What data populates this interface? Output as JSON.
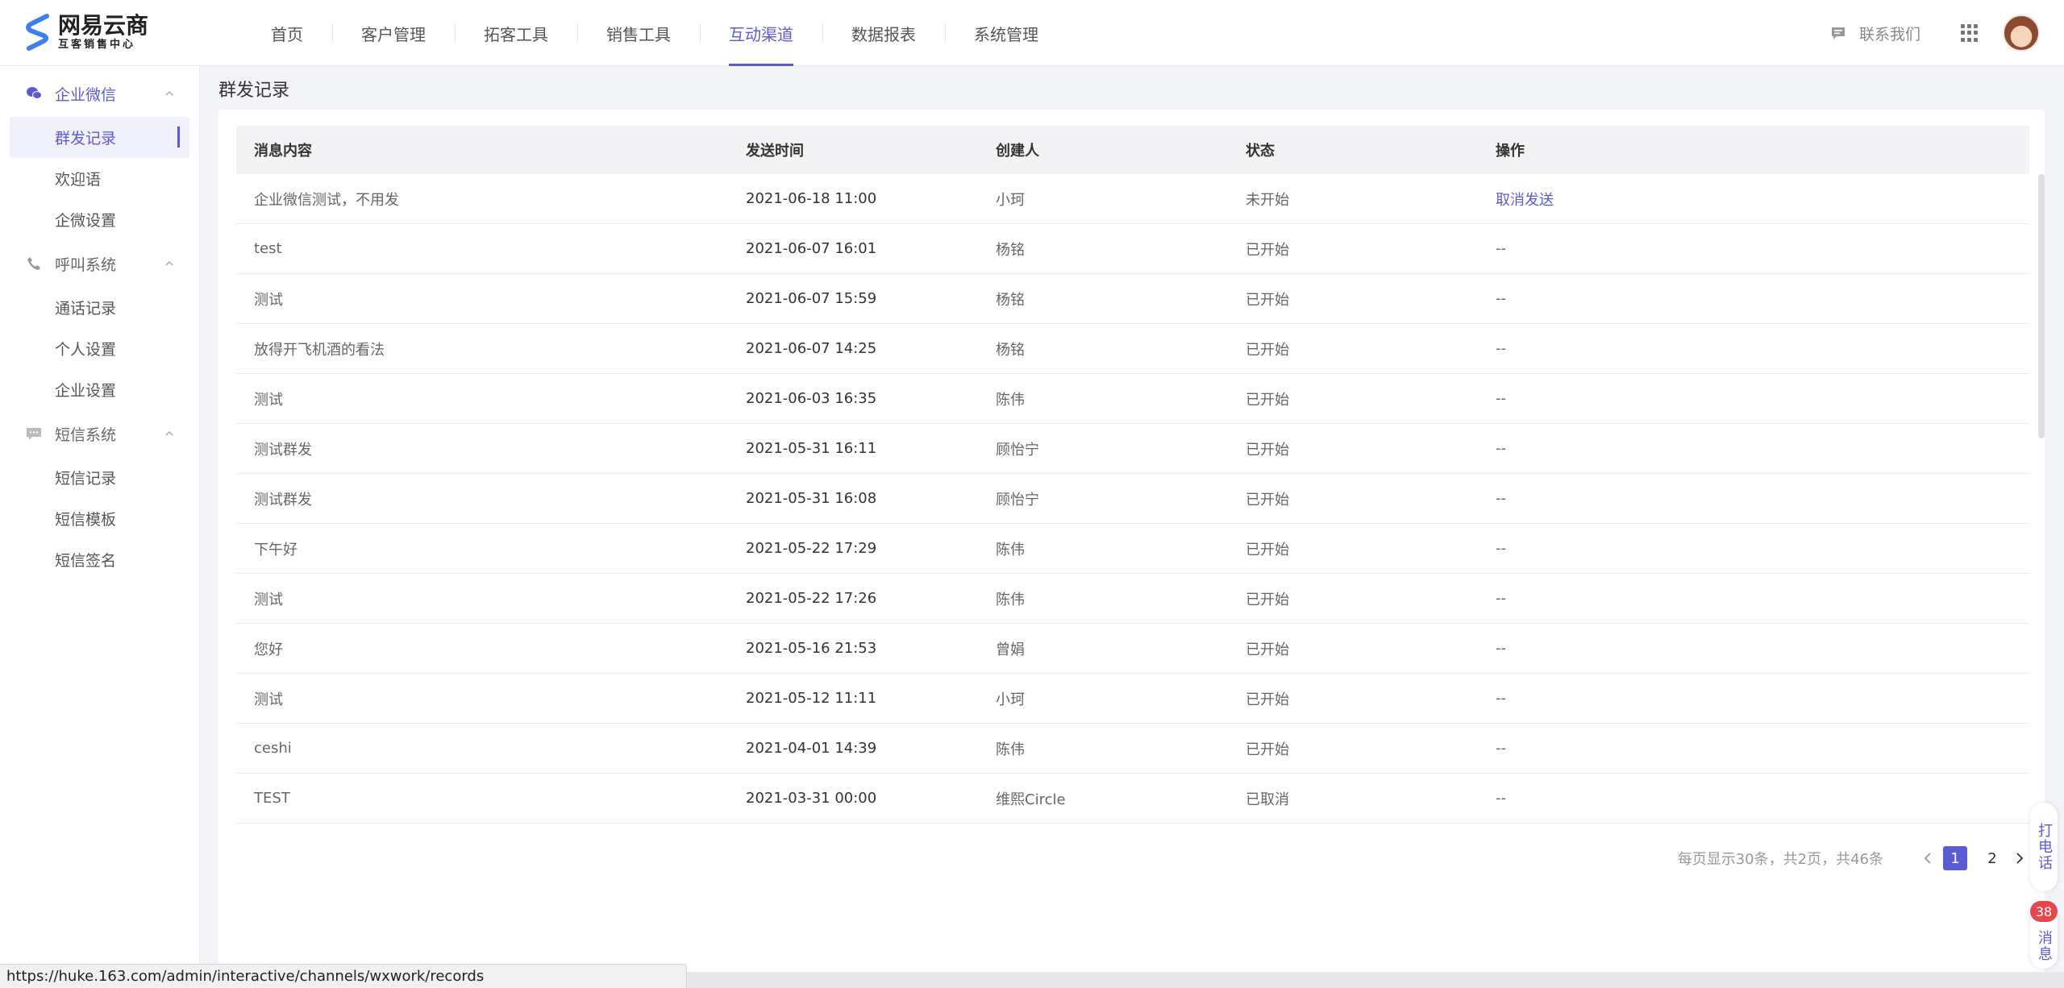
{
  "header": {
    "logo_title": "网易云商",
    "logo_subtitle": "互客销售中心",
    "nav": [
      {
        "label": "首页",
        "active": false
      },
      {
        "label": "客户管理",
        "active": false
      },
      {
        "label": "拓客工具",
        "active": false
      },
      {
        "label": "销售工具",
        "active": false
      },
      {
        "label": "互动渠道",
        "active": true
      },
      {
        "label": "数据报表",
        "active": false
      },
      {
        "label": "系统管理",
        "active": false
      }
    ],
    "contact_label": "联系我们"
  },
  "sidebar": {
    "groups": [
      {
        "label": "企业微信",
        "icon": "wechat-icon",
        "items": [
          "群发记录",
          "欢迎语",
          "企微设置"
        ]
      },
      {
        "label": "呼叫系统",
        "icon": "phone-icon",
        "items": [
          "通话记录",
          "个人设置",
          "企业设置"
        ]
      },
      {
        "label": "短信系统",
        "icon": "sms-icon",
        "items": [
          "短信记录",
          "短信模板",
          "短信签名"
        ]
      }
    ],
    "active_item": "群发记录"
  },
  "page": {
    "title": "群发记录"
  },
  "table": {
    "headers": [
      "消息内容",
      "发送时间",
      "创建人",
      "状态",
      "操作"
    ],
    "rows": [
      {
        "content": "企业微信测试，不用发",
        "time": "2021-06-18 11:00",
        "creator": "小珂",
        "status": "未开始",
        "action": "取消发送"
      },
      {
        "content": "test",
        "time": "2021-06-07 16:01",
        "creator": "杨铭",
        "status": "已开始",
        "action": "--"
      },
      {
        "content": "测试",
        "time": "2021-06-07 15:59",
        "creator": "杨铭",
        "status": "已开始",
        "action": "--"
      },
      {
        "content": "放得开飞机酒的看法",
        "time": "2021-06-07 14:25",
        "creator": "杨铭",
        "status": "已开始",
        "action": "--"
      },
      {
        "content": "测试",
        "time": "2021-06-03 16:35",
        "creator": "陈伟",
        "status": "已开始",
        "action": "--"
      },
      {
        "content": "测试群发",
        "time": "2021-05-31 16:11",
        "creator": "顾怡宁",
        "status": "已开始",
        "action": "--"
      },
      {
        "content": "测试群发",
        "time": "2021-05-31 16:08",
        "creator": "顾怡宁",
        "status": "已开始",
        "action": "--"
      },
      {
        "content": "下午好",
        "time": "2021-05-22 17:29",
        "creator": "陈伟",
        "status": "已开始",
        "action": "--"
      },
      {
        "content": "测试",
        "time": "2021-05-22 17:26",
        "creator": "陈伟",
        "status": "已开始",
        "action": "--"
      },
      {
        "content": "您好",
        "time": "2021-05-16 21:53",
        "creator": "曾娟",
        "status": "已开始",
        "action": "--"
      },
      {
        "content": "测试",
        "time": "2021-05-12 11:11",
        "creator": "小珂",
        "status": "已开始",
        "action": "--"
      },
      {
        "content": "ceshi",
        "time": "2021-04-01 14:39",
        "creator": "陈伟",
        "status": "已开始",
        "action": "--"
      },
      {
        "content": "TEST",
        "time": "2021-03-31 00:00",
        "creator": "维熙Circle",
        "status": "已取消",
        "action": "--"
      }
    ]
  },
  "pagination": {
    "info": "每页显示30条，共2页，共46条",
    "pages": [
      "1",
      "2"
    ],
    "current": "1"
  },
  "floating": {
    "call_label": "打电话",
    "message_label": "消息",
    "message_badge": "38"
  },
  "status_bar": {
    "url": "https://huke.163.com/admin/interactive/channels/wxwork/records"
  },
  "colors": {
    "accent": "#5b5bd6",
    "badge": "#e8454d"
  }
}
